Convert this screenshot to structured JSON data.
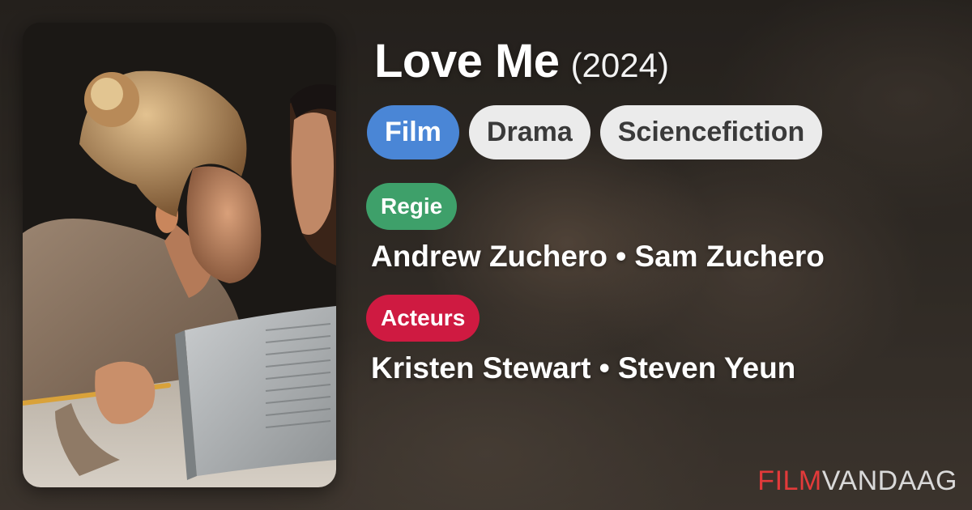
{
  "movie": {
    "title": "Love Me",
    "year": "(2024)"
  },
  "tags": [
    {
      "label": "Film",
      "color": "#4a86d6"
    },
    {
      "label": "Drama",
      "color": "#ebebeb"
    },
    {
      "label": "Sciencefiction",
      "color": "#ebebeb"
    }
  ],
  "directors": {
    "label": "Regie",
    "badge_color": "#3ea06a",
    "names": "Andrew Zuchero • Sam Zuchero"
  },
  "actors": {
    "label": "Acteurs",
    "badge_color": "#cf1a41",
    "names": "Kristen Stewart • Steven Yeun"
  },
  "brand": {
    "part1": "FILM",
    "part2": "VANDAAG",
    "part1_color": "#e23a3a"
  }
}
